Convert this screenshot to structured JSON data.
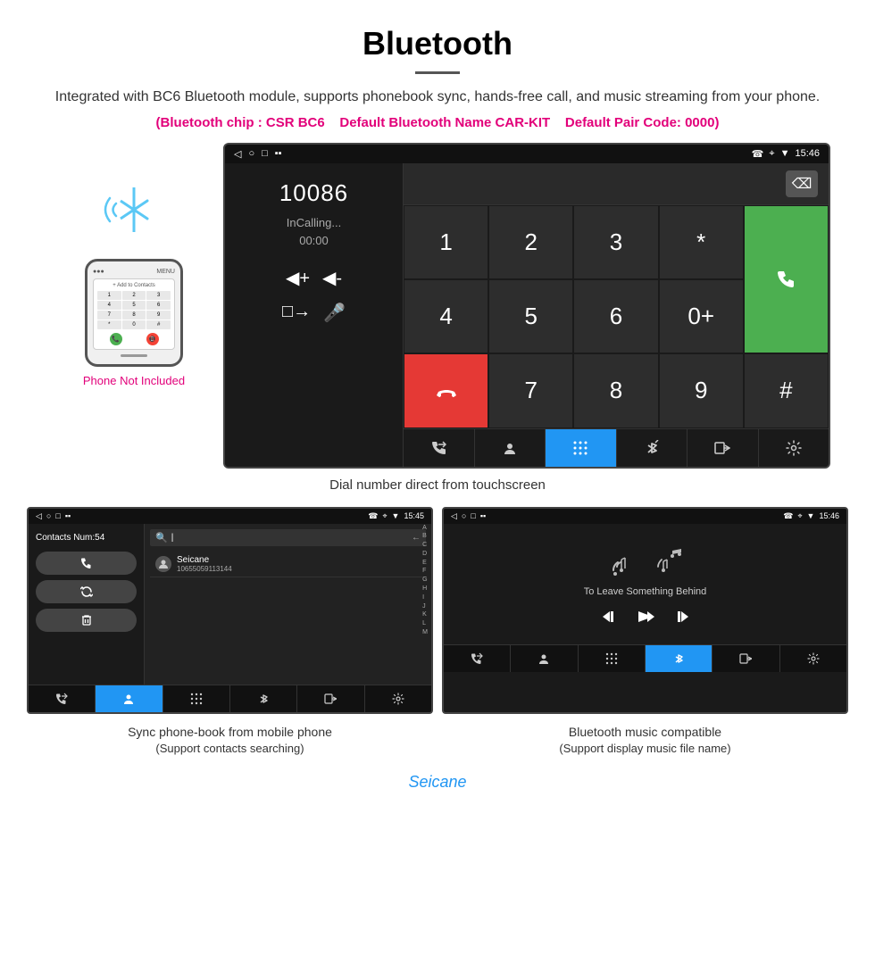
{
  "header": {
    "title": "Bluetooth",
    "description": "Integrated with BC6 Bluetooth module, supports phonebook sync, hands-free call, and music streaming from your phone.",
    "specs": {
      "chip": "(Bluetooth chip : CSR BC6",
      "name": "Default Bluetooth Name CAR-KIT",
      "pair": "Default Pair Code: 0000)"
    }
  },
  "phone": {
    "bluetooth_icon": "⦿",
    "not_included_label": "Phone Not Included",
    "screen": {
      "add_contacts": "+ Add to Contacts",
      "keys": [
        "1",
        "2",
        "3",
        "4",
        "5",
        "6",
        "7",
        "8",
        "9",
        "*",
        "0",
        "#"
      ],
      "call_btn": "📞",
      "end_btn": "📵"
    }
  },
  "main_screen": {
    "statusbar": {
      "left": [
        "◁",
        "○",
        "□",
        "▪▪"
      ],
      "right": "☎  ⌖  ▼  15:46",
      "time": "15:46"
    },
    "dialer": {
      "number": "10086",
      "status": "InCalling...",
      "timer": "00:00",
      "vol_up": "◀+",
      "vol_down": "◀-",
      "transfer": "□→",
      "mic": "🎤"
    },
    "keypad": {
      "keys": [
        "1",
        "2",
        "3",
        "*",
        "4",
        "5",
        "6",
        "0+",
        "7",
        "8",
        "9",
        "#"
      ],
      "call_label": "📞",
      "end_label": "📵",
      "backspace": "⌫"
    },
    "bottom_nav": {
      "items": [
        "☎↗",
        "👤",
        "⊞",
        "⊛",
        "□↗",
        "⚙"
      ]
    },
    "caption": "Dial number direct from touchscreen"
  },
  "contacts_screen": {
    "statusbar_time": "15:45",
    "contacts_num": "Contacts Num:54",
    "buttons": [
      "☎",
      "↻",
      "🗑"
    ],
    "search_placeholder": "",
    "backspace": "←",
    "contact": {
      "name": "Seicane",
      "number": "10655059113144"
    },
    "alpha": [
      "A",
      "B",
      "C",
      "D",
      "E",
      "F",
      "G",
      "H",
      "I",
      "J",
      "K",
      "L",
      "M"
    ],
    "bottom_nav": [
      "☎↗",
      "👤",
      "⊞",
      "⊛",
      "□↗",
      "⚙"
    ],
    "active_tab": 1,
    "caption_main": "Sync phone-book from mobile phone",
    "caption_sub": "(Support contacts searching)"
  },
  "music_screen": {
    "statusbar_time": "15:46",
    "song_title": "To Leave Something Behind",
    "controls": [
      "⏮",
      "⏭",
      "⏭"
    ],
    "bottom_nav": [
      "☎↗",
      "👤",
      "⊞",
      "⊛",
      "□↗",
      "⚙"
    ],
    "active_tab": 3,
    "caption_main": "Bluetooth music compatible",
    "caption_sub": "(Support display music file name)"
  },
  "watermark": "Seicane"
}
